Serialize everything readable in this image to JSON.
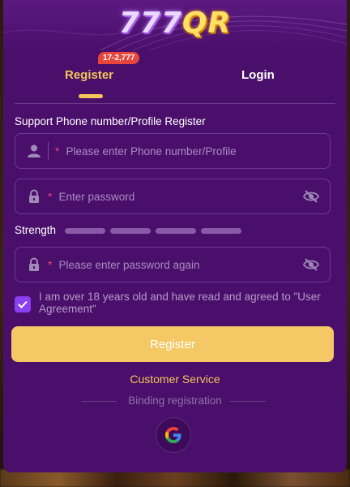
{
  "logo": {
    "num": "777",
    "qr": "QR"
  },
  "tabs": {
    "register_label": "Register",
    "login_label": "Login",
    "badge": "17-2,777"
  },
  "form": {
    "section_title": "Support Phone number/Profile Register",
    "required_mark": "*",
    "phone_placeholder": "Please enter Phone number/Profile",
    "password_placeholder": "Enter password",
    "confirm_placeholder": "Please enter password again",
    "strength_label": "Strength",
    "strength_segments": 4,
    "agree_checked": true,
    "agree_text": "I am over 18 years old and have read and agreed to \"User Agreement\""
  },
  "actions": {
    "register_button": "Register",
    "customer_service": "Customer Service",
    "binding_label": "Binding registration",
    "google_icon": "google-icon"
  },
  "colors": {
    "modal_bg": "#4a0f6b",
    "accent_gold": "#f4c65a",
    "button_bg": "#f4c865",
    "checkbox": "#8a3ff0",
    "badge": "#e8453c"
  }
}
